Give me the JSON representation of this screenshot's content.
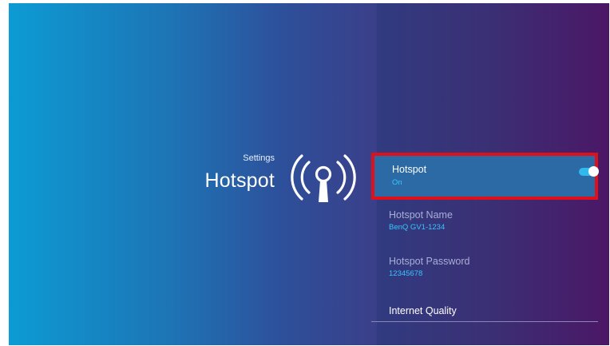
{
  "header": {
    "section_label": "Settings",
    "title": "Hotspot"
  },
  "settings": [
    {
      "label": "Hotspot",
      "value": "On"
    },
    {
      "label": "Hotspot Name",
      "value": "BenQ GV1-1234"
    },
    {
      "label": "Hotspot Password",
      "value": "12345678"
    },
    {
      "label": "Internet Quality"
    }
  ],
  "toggle": {
    "hotspot_enabled": true
  },
  "icons": {
    "hero": "wifi-hotspot-icon"
  },
  "colors": {
    "accent": "#37c6ff",
    "focus_border": "#e0101b",
    "selected_row": "#2b6aa5"
  }
}
